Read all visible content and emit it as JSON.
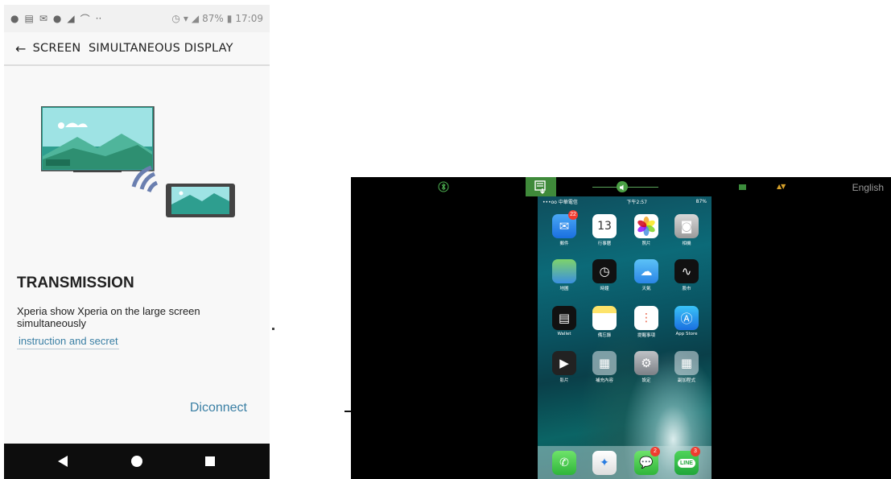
{
  "android": {
    "status_bar": {
      "battery": "87%",
      "time": "17:09"
    },
    "app_bar": {
      "back_glyph": "←",
      "title": "SCREEN  SIMULTANEOUS DISPLAY"
    },
    "heading": "TRANSMISSION",
    "description": "Xperia show Xperia on the large screen simultaneously",
    "link": "instruction and secret",
    "disconnect": "Diconnect"
  },
  "tv_toolbar": {
    "language": "English"
  },
  "iphone": {
    "status_left": "•••oo 中華電信 ",
    "status_time": "下午2:57",
    "status_right": "87%",
    "apps": [
      {
        "name": "mail-app",
        "label": "郵件",
        "badge": "22"
      },
      {
        "name": "calendar-app",
        "label": "行事曆",
        "day": "13"
      },
      {
        "name": "photos-app",
        "label": "照片"
      },
      {
        "name": "camera-app",
        "label": "相機"
      },
      {
        "name": "maps-app",
        "label": "地圖"
      },
      {
        "name": "clock-app",
        "label": "時鐘"
      },
      {
        "name": "weather-app",
        "label": "天氣"
      },
      {
        "name": "stocks-app",
        "label": "股市"
      },
      {
        "name": "wallet-app",
        "label": "Wallet"
      },
      {
        "name": "notes-app",
        "label": "備忘錄"
      },
      {
        "name": "reminders-app",
        "label": "提醒事項"
      },
      {
        "name": "appstore-app",
        "label": "App Store"
      },
      {
        "name": "videos-app",
        "label": "影片"
      },
      {
        "name": "extras-folder",
        "label": "補充內容"
      },
      {
        "name": "settings-app",
        "label": "設定"
      },
      {
        "name": "productivity-folder",
        "label": "副加程式"
      }
    ],
    "dock": [
      {
        "name": "phone-app"
      },
      {
        "name": "safari-app"
      },
      {
        "name": "messages-app",
        "badge": "2"
      },
      {
        "name": "line-app",
        "badge": "3",
        "text": "LINE"
      }
    ]
  }
}
